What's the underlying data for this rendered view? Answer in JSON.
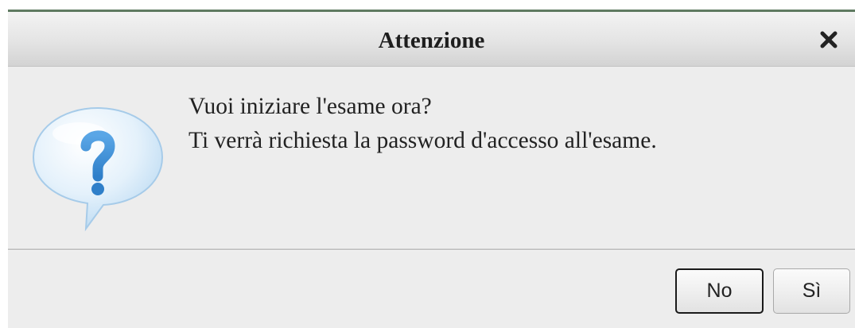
{
  "dialog": {
    "title": "Attenzione",
    "close_icon": "close-x-icon",
    "message_icon": "question-bubble-icon",
    "message_lines": [
      "Vuoi iniziare l'esame ora?",
      "Ti verrà richiesta la password d'accesso all'esame."
    ],
    "buttons": {
      "no_label": "No",
      "si_label": "Sì"
    },
    "focused_button": "No"
  },
  "colors": {
    "title_bar_accent": "#5f7a61",
    "dialog_background": "#ededed",
    "icon_bubble": "#cfe6f8",
    "icon_glyph": "#3d8fd6"
  }
}
